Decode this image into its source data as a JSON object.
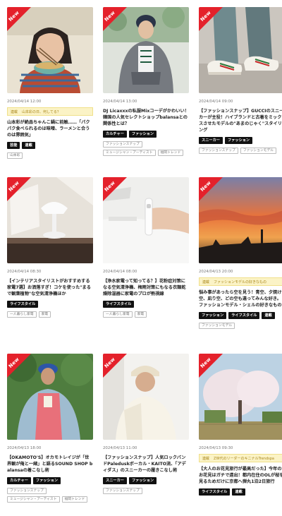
{
  "badge_new": "New",
  "colors": {
    "new_ribbon": "#e4212b",
    "sponsor_bg": "#fbf3c6",
    "tag_dark_bg": "#111111"
  },
  "cards": [
    {
      "date": "2024/04/14 12:00",
      "sponsor": {
        "label": "連載",
        "text": "山本彩の日、何してる？"
      },
      "title": "山本彩が絶品ちゃんこ鍋に前触……「パクパク食べられるのは味噌、ラーメンと合うのは雰囲気」",
      "tags": [
        "芸能",
        "連載"
      ],
      "tags_light": [
        "山本彩"
      ],
      "image": "woman-eating-bowl"
    },
    {
      "date": "2024/04/14 13:00",
      "sponsor": null,
      "title": "DJ Licaxxxの私服Mixコーデがかわいい！韓国の人気セレクトショップbalansaとの関係性とは？",
      "tags": [
        "カルチャー",
        "ファッション"
      ],
      "tags_light": [
        "ファッションスナップ",
        "ミュージシャン・アーティスト",
        "福岡トレンド"
      ],
      "image": "person-gray-hoodie"
    },
    {
      "date": "2024/04/14 09:00",
      "sponsor": null,
      "title": "【ファッションスナップ】GUCCIのスニーカーが主役！ハイブランドと古着をミックスさせたモデルの\"あまのじゃく\"スタイリング",
      "tags": [
        "スニーカー",
        "ファッション"
      ],
      "tags_light": [
        "ファッションスナップ",
        "ファッションモデル"
      ],
      "image": "sneakers-jeans"
    },
    {
      "date": "2024/04/14 08:30",
      "sponsor": null,
      "title": "【インテリアスタイリストがおすすめする家電7選】お洒落すぎ！コケを使った\"まるで観葉植物\"な空気清浄機ほか",
      "tags": [
        "ライフスタイル"
      ],
      "tags_light": [
        "一人暮らし家電",
        "家電"
      ],
      "image": "white-lamp-appliance"
    },
    {
      "date": "2024/04/14 08:00",
      "sponsor": null,
      "title": "【浄水家電って知ってる？】花粉症対策になる空気清浄機、梅雨対策にもなる衣類乾燥除湿器に家電のプロが熱視線",
      "tags": [
        "ライフスタイル"
      ],
      "tags_light": [
        "一人暮らし家電",
        "家電"
      ],
      "image": "handheld-appliance"
    },
    {
      "date": "2024/04/13 20:00",
      "sponsor": {
        "label": "連載",
        "text": "ファッションモデルの好きなもの"
      },
      "title": "悩み事があったら空を見う！青空、夕焼け空、凪り空、どの空も違ってみんな好き。ファッションモデル・シェルの好きなもの",
      "tags": [
        "ファッション",
        "ライフスタイル",
        "連載"
      ],
      "tags_light": [
        "ファッションモデル"
      ],
      "image": "sunset-sky"
    },
    {
      "date": "2024/04/13 18:00",
      "sponsor": null,
      "title": "【OKAMOTO'S】オカモトレイジが「世界観が俺と一緒」と語るSOUND SHOP balansaの着こなし術",
      "tags": [
        "カルチャー",
        "ファッション"
      ],
      "tags_light": [
        "ファッションスナップ",
        "ミュージシャン・アーティスト",
        "福岡トレンド"
      ],
      "image": "man-blue-cap-trees"
    },
    {
      "date": "2024/04/13 11:00",
      "sponsor": null,
      "title": "【ファッションスナップ】人気ロックバンドPaleduskボーカル・KAITO流、「アディダス」のスニーカーの履きこなし術",
      "tags": [
        "スニーカー",
        "ファッション"
      ],
      "tags_light": [
        "ファッションスナップ"
      ],
      "image": "man-beanie-wall"
    },
    {
      "date": "2024/04/13 09:30",
      "sponsor": {
        "label": "連載",
        "text": "Z世代のリーダーのキニナルTrendspa"
      },
      "title": "【大人のお花見旅行が最高だった】今年のお花見はガチで遠出！都内在住のOLが桜を見るためだけに京都へ弾丸1泊2日旅行",
      "tags": [
        "ライフスタイル",
        "連載"
      ],
      "tags_light": [],
      "image": "cherry-blossom-tree"
    }
  ]
}
